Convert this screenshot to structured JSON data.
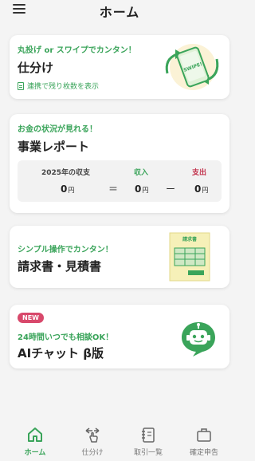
{
  "header": {
    "title": "ホーム"
  },
  "cards": [
    {
      "subtitle": "丸投げ or スワイプでカンタン！",
      "title": "仕分け",
      "link": "連携で残り枚数を表示",
      "illustration_text": "SWIPE!"
    },
    {
      "subtitle": "お金の状況が見れる！",
      "title": "事業レポート",
      "report": {
        "year_label": "2025年の収支",
        "income_label": "収入",
        "expense_label": "支出",
        "balance": "0",
        "income": "0",
        "expense": "0",
        "currency": "円",
        "eq": "＝",
        "minus": "ー"
      }
    },
    {
      "subtitle": "シンプル操作でカンタン！",
      "title": "請求書・見積書",
      "illustration_text": "請求書"
    },
    {
      "badge": "NEW",
      "subtitle": "24時間いつでも相談OK！",
      "title": "AIチャット β版"
    }
  ],
  "nav": [
    {
      "label": "ホーム",
      "icon": "home-icon",
      "active": true
    },
    {
      "label": "仕分け",
      "icon": "swipe-hand-icon",
      "active": false
    },
    {
      "label": "取引一覧",
      "icon": "notebook-icon",
      "active": false
    },
    {
      "label": "確定申告",
      "icon": "briefcase-icon",
      "active": false
    }
  ],
  "colors": {
    "accent": "#3aa45a",
    "expense": "#c2334d",
    "badge": "#d8486b",
    "background": "#f4f4f4"
  }
}
